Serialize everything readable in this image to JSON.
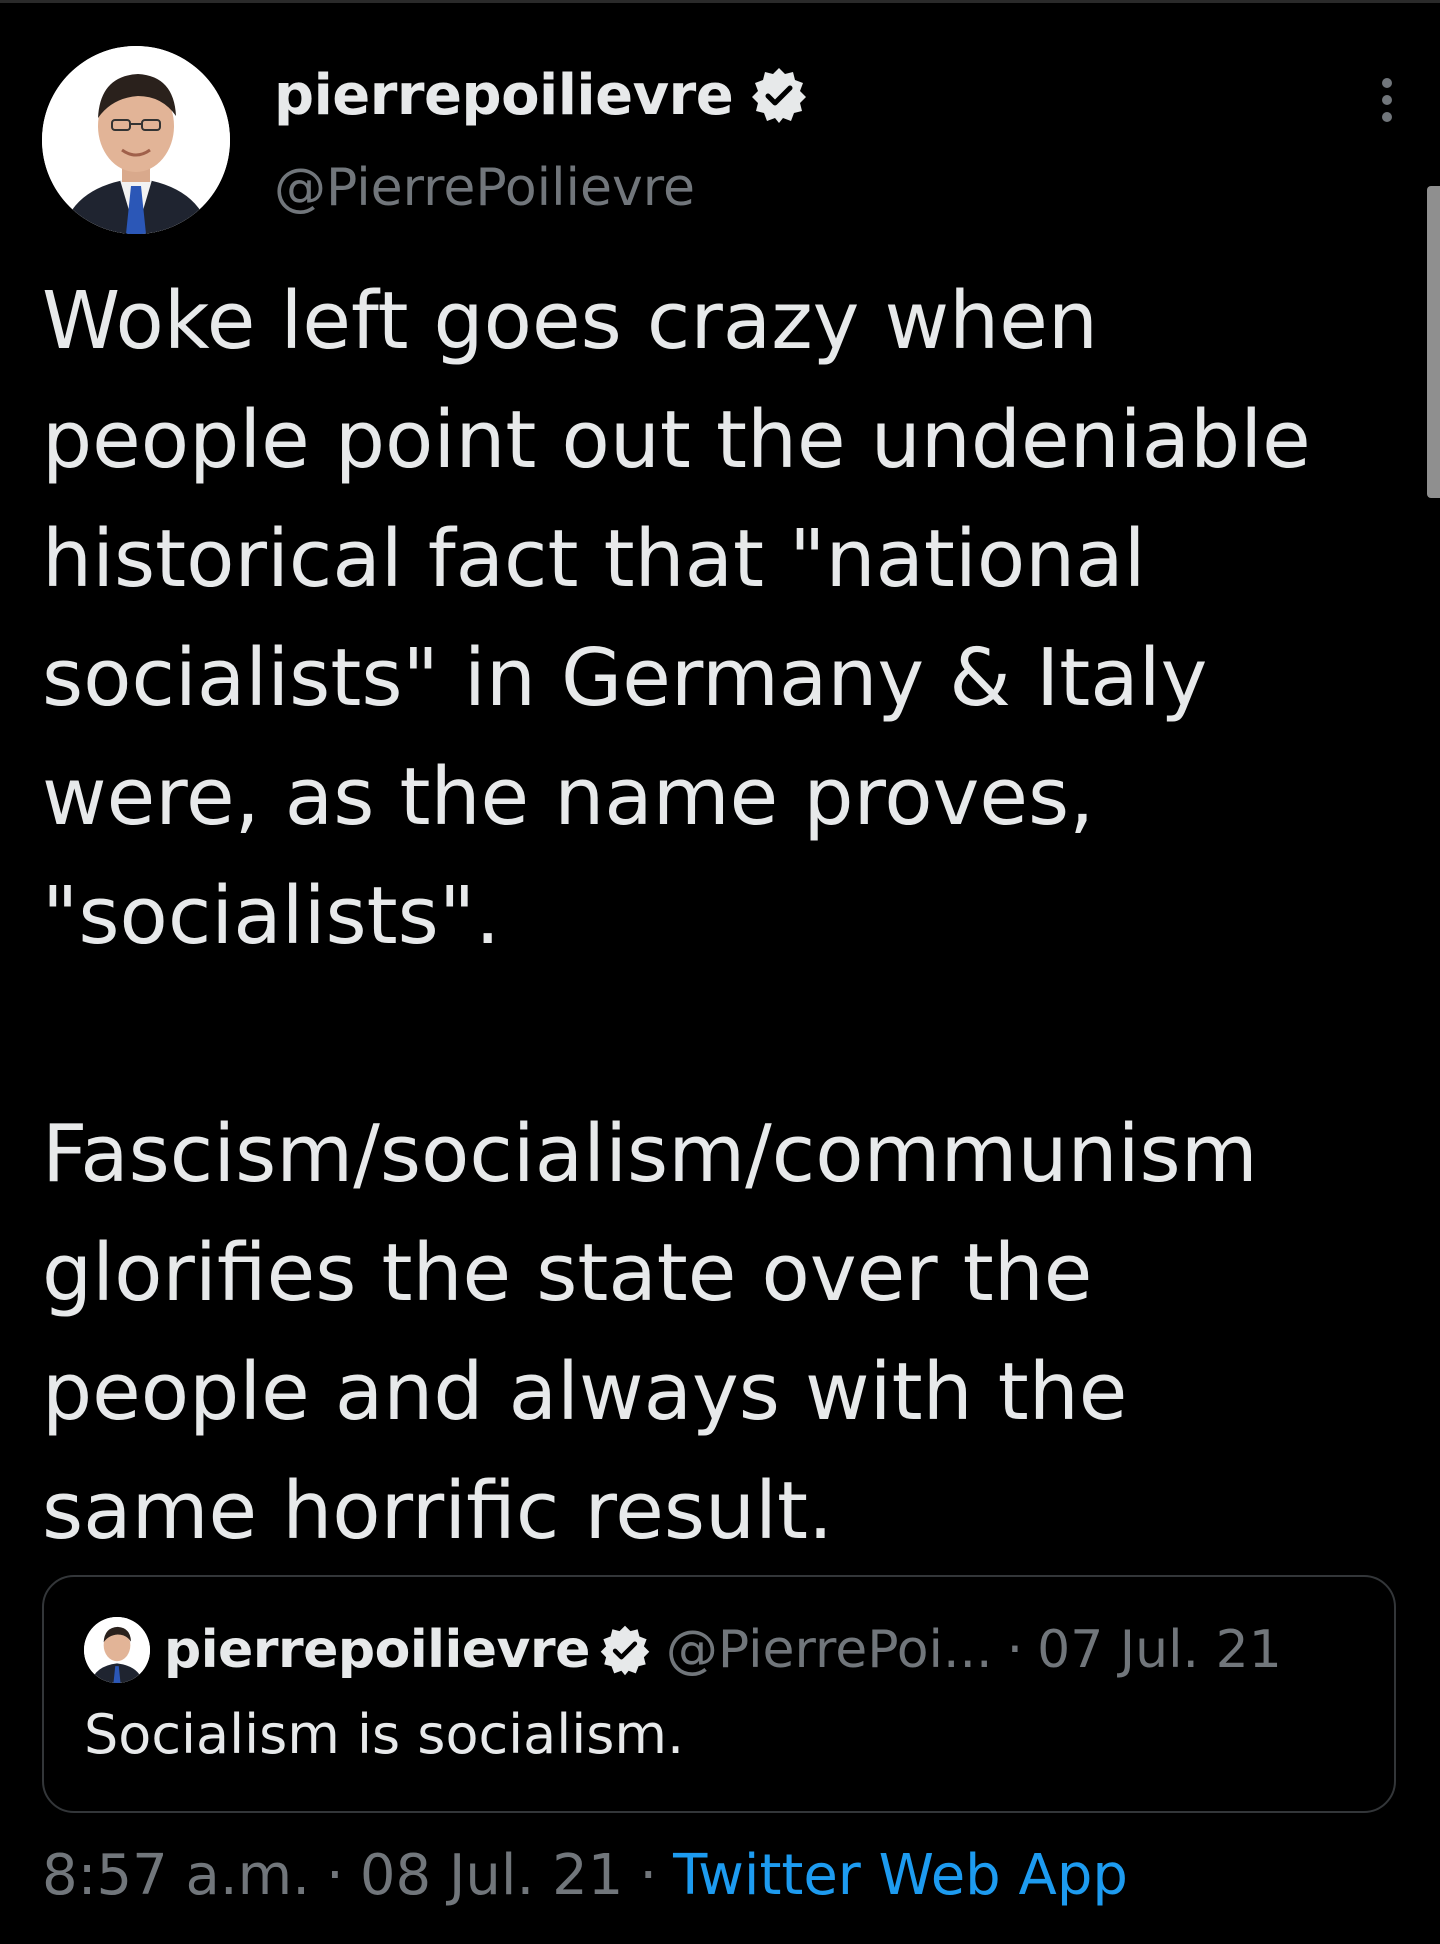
{
  "tweet": {
    "author": {
      "display_name": "pierrepoilievre",
      "handle": "@PierrePoilievre",
      "verified": true
    },
    "text": "Woke left goes crazy when\npeople point out the undeniable\nhistorical fact that \"national\nsocialists\" in Germany & Italy\nwere, as the name proves,\n\"socialists\".\n\nFascism/socialism/communism\nglorifies the state over the\npeople and always with the\nsame horrific result.",
    "quoted": {
      "display_name": "pierrepoilievre",
      "handle": "@PierrePoi...",
      "separator": "·",
      "date": "07 Jul. 21",
      "text": "Socialism is socialism."
    },
    "meta": {
      "time": "8:57 a.m.",
      "separator": "·",
      "date": "08 Jul. 21",
      "source": "Twitter Web App"
    }
  },
  "icons": {
    "verified": "verified-badge-icon",
    "more": "more-options-icon"
  },
  "colors": {
    "background": "#000000",
    "text_primary": "#e7e9ea",
    "text_secondary": "#71767b",
    "accent": "#1d9bf0",
    "border": "#333639"
  }
}
